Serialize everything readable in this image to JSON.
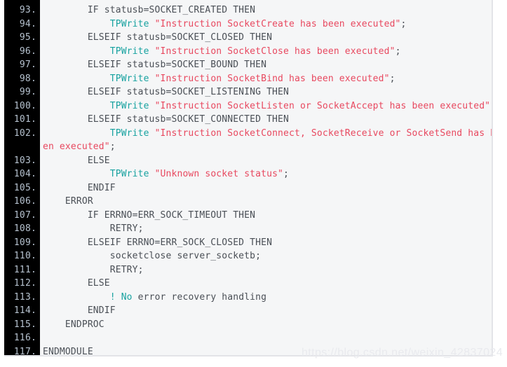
{
  "editor": {
    "language": "RAPID",
    "gutter_background": "#000000",
    "gutter_color": "#b6c2cf",
    "code_background": "#f5f6f7",
    "code_color": "#4a4f56",
    "keyword_color": "#17a2a0",
    "string_color": "#e8485f",
    "first_line": 93,
    "last_line": 117,
    "line_numbers": [
      "93.",
      "94.",
      "95.",
      "96.",
      "97.",
      "98.",
      "99.",
      "100.",
      "101.",
      "102.",
      "",
      "103.",
      "104.",
      "105.",
      "106.",
      "107.",
      "108.",
      "109.",
      "110.",
      "111.",
      "112.",
      "113.",
      "114.",
      "115.",
      "116.",
      "117."
    ],
    "lines": [
      {
        "number": "93.",
        "text": "        IF statusb=SOCKET_CREATED THEN",
        "tokens": [
          {
            "t": "        IF statusb=SOCKET_CREATED THEN",
            "c": "plain"
          }
        ]
      },
      {
        "number": "94.",
        "text": "            TPWrite \"Instruction SocketCreate has been executed\";",
        "tokens": [
          {
            "t": "            ",
            "c": "plain"
          },
          {
            "t": "TPWrite",
            "c": "kw"
          },
          {
            "t": " ",
            "c": "plain"
          },
          {
            "t": "\"Instruction SocketCreate has been executed\"",
            "c": "str"
          },
          {
            "t": ";",
            "c": "plain"
          }
        ]
      },
      {
        "number": "95.",
        "text": "        ELSEIF statusb=SOCKET_CLOSED THEN",
        "tokens": [
          {
            "t": "        ELSEIF statusb=SOCKET_CLOSED THEN",
            "c": "plain"
          }
        ]
      },
      {
        "number": "96.",
        "text": "            TPWrite \"Instruction SocketClose has been executed\";",
        "tokens": [
          {
            "t": "            ",
            "c": "plain"
          },
          {
            "t": "TPWrite",
            "c": "kw"
          },
          {
            "t": " ",
            "c": "plain"
          },
          {
            "t": "\"Instruction SocketClose has been executed\"",
            "c": "str"
          },
          {
            "t": ";",
            "c": "plain"
          }
        ]
      },
      {
        "number": "97.",
        "text": "        ELSEIF statusb=SOCKET_BOUND THEN",
        "tokens": [
          {
            "t": "        ELSEIF statusb=SOCKET_BOUND THEN",
            "c": "plain"
          }
        ]
      },
      {
        "number": "98.",
        "text": "            TPWrite \"Instruction SocketBind has been executed\";",
        "tokens": [
          {
            "t": "            ",
            "c": "plain"
          },
          {
            "t": "TPWrite",
            "c": "kw"
          },
          {
            "t": " ",
            "c": "plain"
          },
          {
            "t": "\"Instruction SocketBind has been executed\"",
            "c": "str"
          },
          {
            "t": ";",
            "c": "plain"
          }
        ]
      },
      {
        "number": "99.",
        "text": "        ELSEIF statusb=SOCKET_LISTENING THEN",
        "tokens": [
          {
            "t": "        ELSEIF statusb=SOCKET_LISTENING THEN",
            "c": "plain"
          }
        ]
      },
      {
        "number": "100.",
        "text": "            TPWrite \"Instruction SocketListen or SocketAccept has been executed\";",
        "tokens": [
          {
            "t": "            ",
            "c": "plain"
          },
          {
            "t": "TPWrite",
            "c": "kw"
          },
          {
            "t": " ",
            "c": "plain"
          },
          {
            "t": "\"Instruction SocketListen or SocketAccept has been executed\"",
            "c": "str"
          },
          {
            "t": ";",
            "c": "plain"
          }
        ]
      },
      {
        "number": "101.",
        "text": "        ELSEIF statusb=SOCKET_CONNECTED THEN",
        "tokens": [
          {
            "t": "        ELSEIF statusb=SOCKET_CONNECTED THEN",
            "c": "plain"
          }
        ]
      },
      {
        "number": "102.",
        "text": "            TPWrite \"Instruction SocketConnect, SocketReceive or SocketSend has be",
        "tokens": [
          {
            "t": "            ",
            "c": "plain"
          },
          {
            "t": "TPWrite",
            "c": "kw"
          },
          {
            "t": " ",
            "c": "plain"
          },
          {
            "t": "\"Instruction SocketConnect, SocketReceive or SocketSend has be",
            "c": "str"
          }
        ]
      },
      {
        "number": "",
        "text": "en executed\";",
        "wrapped": true,
        "tokens": [
          {
            "t": "en executed\"",
            "c": "str"
          },
          {
            "t": ";",
            "c": "plain"
          }
        ]
      },
      {
        "number": "103.",
        "text": "        ELSE",
        "tokens": [
          {
            "t": "        ELSE",
            "c": "plain"
          }
        ]
      },
      {
        "number": "104.",
        "text": "            TPWrite \"Unknown socket status\";",
        "tokens": [
          {
            "t": "            ",
            "c": "plain"
          },
          {
            "t": "TPWrite",
            "c": "kw"
          },
          {
            "t": " ",
            "c": "plain"
          },
          {
            "t": "\"Unknown socket status\"",
            "c": "str"
          },
          {
            "t": ";",
            "c": "plain"
          }
        ]
      },
      {
        "number": "105.",
        "text": "        ENDIF",
        "tokens": [
          {
            "t": "        ENDIF",
            "c": "plain"
          }
        ]
      },
      {
        "number": "106.",
        "text": "    ERROR",
        "tokens": [
          {
            "t": "    ERROR",
            "c": "plain"
          }
        ]
      },
      {
        "number": "107.",
        "text": "        IF ERRNO=ERR_SOCK_TIMEOUT THEN",
        "tokens": [
          {
            "t": "        IF ERRNO=ERR_SOCK_TIMEOUT THEN",
            "c": "plain"
          }
        ]
      },
      {
        "number": "108.",
        "text": "            RETRY;",
        "tokens": [
          {
            "t": "            RETRY;",
            "c": "plain"
          }
        ]
      },
      {
        "number": "109.",
        "text": "        ELSEIF ERRNO=ERR_SOCK_CLOSED THEN",
        "tokens": [
          {
            "t": "        ELSEIF ERRNO=ERR_SOCK_CLOSED THEN",
            "c": "plain"
          }
        ]
      },
      {
        "number": "110.",
        "text": "            socketclose server_socketb;",
        "tokens": [
          {
            "t": "            socketclose server_socketb;",
            "c": "plain"
          }
        ]
      },
      {
        "number": "111.",
        "text": "            RETRY;",
        "tokens": [
          {
            "t": "            RETRY;",
            "c": "plain"
          }
        ]
      },
      {
        "number": "112.",
        "text": "        ELSE",
        "tokens": [
          {
            "t": "        ELSE",
            "c": "plain"
          }
        ]
      },
      {
        "number": "113.",
        "text": "            ! No error recovery handling",
        "tokens": [
          {
            "t": "            ",
            "c": "plain"
          },
          {
            "t": "!",
            "c": "cmtkw"
          },
          {
            "t": " ",
            "c": "plain"
          },
          {
            "t": "No",
            "c": "cmtkw"
          },
          {
            "t": " error recovery handling",
            "c": "cmt"
          }
        ]
      },
      {
        "number": "114.",
        "text": "        ENDIF",
        "tokens": [
          {
            "t": "        ENDIF",
            "c": "plain"
          }
        ]
      },
      {
        "number": "115.",
        "text": "    ENDPROC",
        "tokens": [
          {
            "t": "    ENDPROC",
            "c": "plain"
          }
        ]
      },
      {
        "number": "116.",
        "text": "",
        "tokens": [
          {
            "t": "",
            "c": "plain"
          }
        ]
      },
      {
        "number": "117.",
        "text": "ENDMODULE",
        "tokens": [
          {
            "t": "ENDMODULE",
            "c": "plain"
          }
        ]
      }
    ]
  },
  "watermark": {
    "text": "https://blog.csdn.net/weixin_42837024",
    "color": "#e9eaee"
  }
}
